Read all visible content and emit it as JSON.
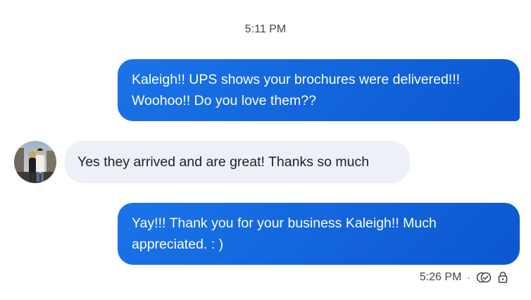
{
  "thread": {
    "time_divider": "5:11 PM",
    "messages": [
      {
        "direction": "outgoing",
        "lines": [
          "Kaleigh!! UPS shows your brochures were delivered!!!",
          "Woohoo!! Do you love them??"
        ]
      },
      {
        "direction": "incoming",
        "text": "Yes they arrived and are great! Thanks so much"
      },
      {
        "direction": "outgoing",
        "lines": [
          "Yay!!! Thank you for your business Kaleigh!! Much",
          "appreciated. : )"
        ]
      }
    ],
    "last_message_status": {
      "time": "5:26 PM",
      "separator": "·",
      "read_icon": "double-check-circle-icon",
      "lock_icon": "lock-icon"
    }
  },
  "colors": {
    "outgoing_bubble": "#0b57d0",
    "incoming_bubble": "#eef0f8",
    "meta_text": "#444746"
  }
}
